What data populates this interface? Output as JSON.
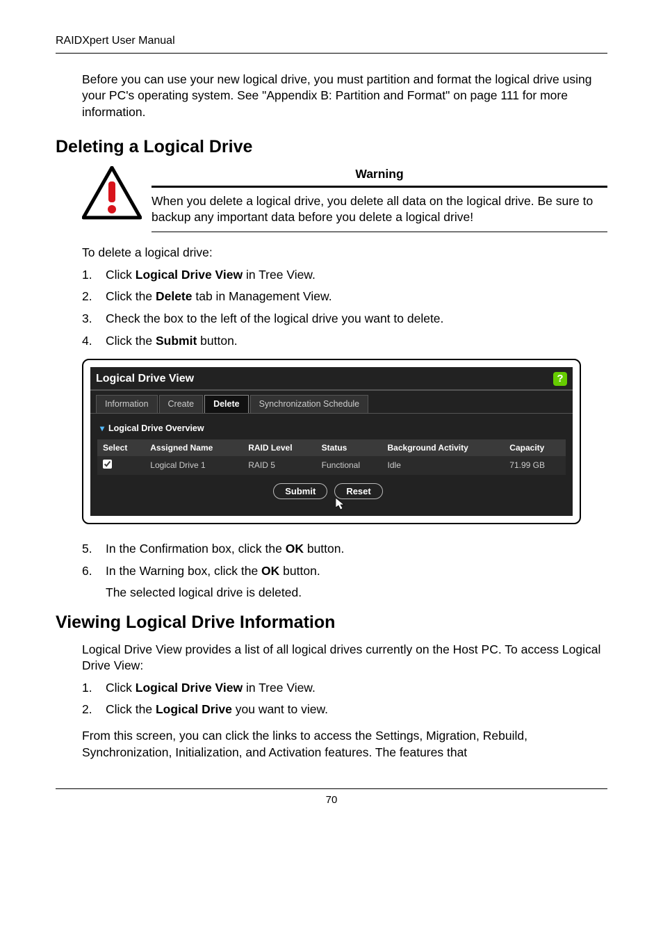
{
  "header": "RAIDXpert User Manual",
  "intro_para": "Before you can use your new logical drive, you must partition and format the logical drive using your PC's operating system. See \"Appendix B: Partition and Format\" on page 111 for more information.",
  "section1_title": "Deleting a Logical Drive",
  "warning": {
    "title": "Warning",
    "text": "When you delete a logical drive, you delete all data on the logical drive. Be sure to backup any important data before you delete a logical drive!"
  },
  "delete_intro": "To delete a logical drive:",
  "delete_steps_a": [
    {
      "n": "1.",
      "pre": "Click ",
      "bold": "Logical Drive View",
      "post": " in Tree View."
    },
    {
      "n": "2.",
      "pre": "Click the ",
      "bold": "Delete",
      "post": " tab in Management View."
    },
    {
      "n": "3.",
      "pre": "Check the box to the left of the logical drive you want to delete.",
      "bold": "",
      "post": ""
    },
    {
      "n": "4.",
      "pre": "Click the ",
      "bold": "Submit",
      "post": " button."
    }
  ],
  "ui": {
    "title": "Logical Drive View",
    "help_icon": "?",
    "tabs": [
      "Information",
      "Create",
      "Delete",
      "Synchronization Schedule"
    ],
    "active_tab_index": 2,
    "subheader": "Logical Drive Overview",
    "columns": [
      "Select",
      "Assigned Name",
      "RAID Level",
      "Status",
      "Background Activity",
      "Capacity"
    ],
    "rows": [
      {
        "checked": true,
        "name": "Logical Drive 1",
        "raid": "RAID 5",
        "status": "Functional",
        "activity": "Idle",
        "capacity": "71.99 GB"
      }
    ],
    "buttons": {
      "submit": "Submit",
      "reset": "Reset"
    }
  },
  "delete_steps_b": [
    {
      "n": "5.",
      "pre": "In the Confirmation box, click the ",
      "bold": "OK",
      "post": " button."
    },
    {
      "n": "6.",
      "pre": "In the Warning box, click the ",
      "bold": "OK",
      "post": " button.",
      "sub": "The selected logical drive is deleted."
    }
  ],
  "section2_title": "Viewing Logical Drive Information",
  "view_intro": "Logical Drive View provides a list of all logical drives currently on the Host PC. To access Logical Drive View:",
  "view_steps": [
    {
      "n": "1.",
      "pre": "Click ",
      "bold": "Logical Drive View",
      "post": " in Tree View."
    },
    {
      "n": "2.",
      "pre": "Click the ",
      "bold": "Logical Drive",
      "post": " you want to view."
    }
  ],
  "view_post": "From this screen, you can click the links to access the Settings, Migration, Rebuild, Synchronization, Initialization, and Activation features. The features that",
  "page_number": "70"
}
